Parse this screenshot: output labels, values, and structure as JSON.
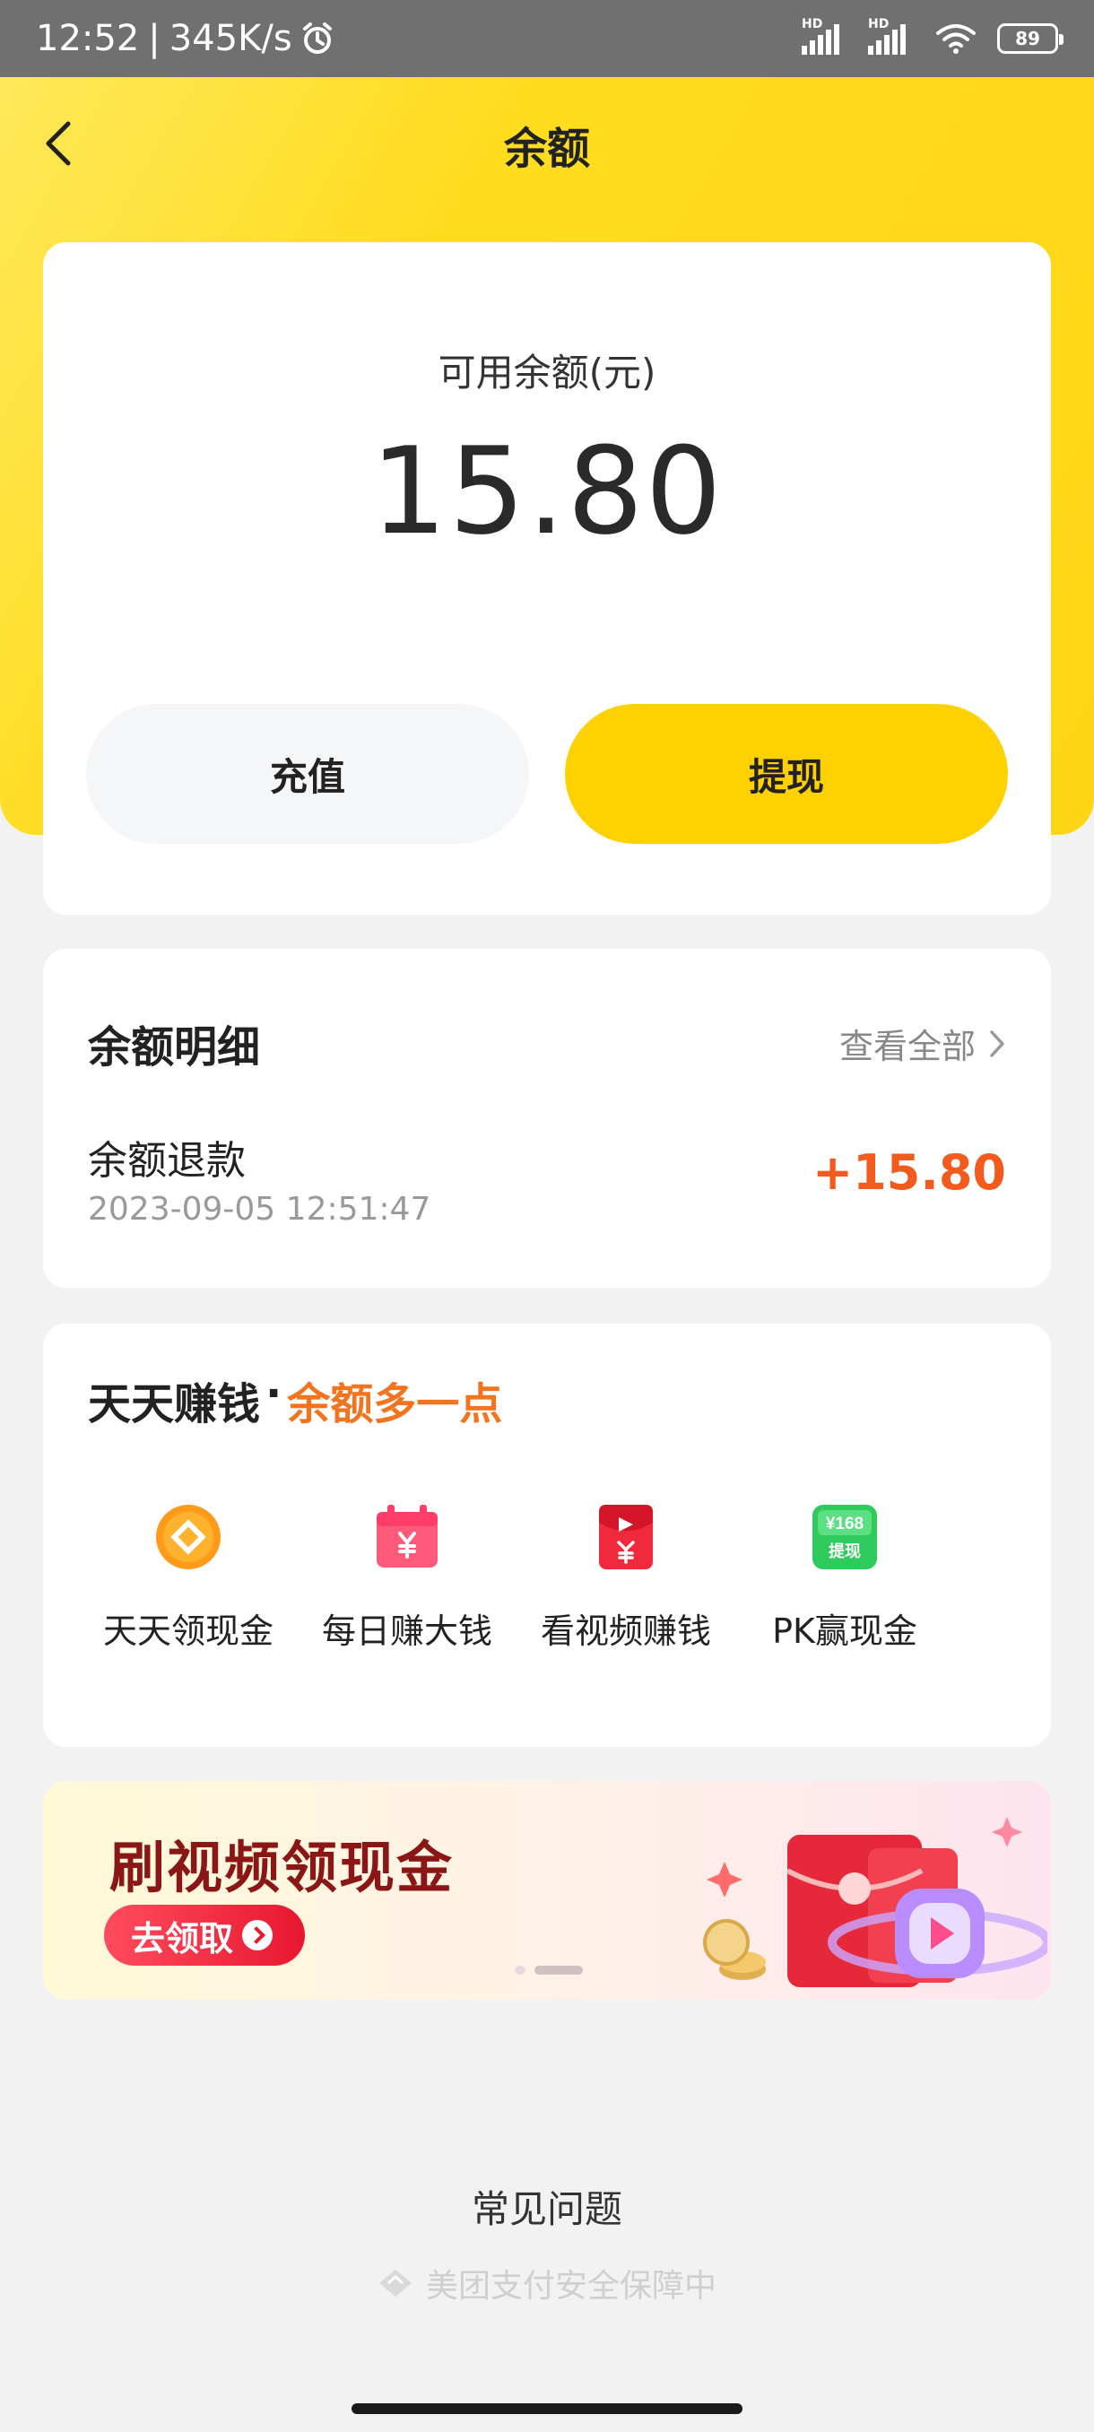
{
  "status_bar": {
    "time": "12:52",
    "network_speed": "345K/s",
    "signal_label_1": "HD",
    "signal_label_2": "HD",
    "battery": "89",
    "icons": [
      "alarm-icon",
      "signal-icon",
      "signal-icon",
      "wifi-icon",
      "battery-icon"
    ]
  },
  "nav": {
    "title": "余额",
    "back_icon": "chevron-left-icon"
  },
  "balance": {
    "label": "可用余额(元)",
    "amount": "15.80",
    "recharge_label": "充值",
    "withdraw_label": "提现"
  },
  "detail": {
    "title": "余额明细",
    "view_all": "查看全部",
    "transactions": [
      {
        "name": "余额退款",
        "time": "2023-09-05 12:51:47",
        "amount": "+15.80"
      }
    ]
  },
  "earn": {
    "title_main": "天天赚钱",
    "title_sep": "·",
    "title_accent": "余额多一点",
    "items": [
      {
        "label": "天天领现金",
        "icon": "coin-icon"
      },
      {
        "label": "每日赚大钱",
        "icon": "calendar-yuan-icon"
      },
      {
        "label": "看视频赚钱",
        "icon": "red-envelope-icon"
      },
      {
        "label": "PK赢现金",
        "icon": "withdraw-168-icon",
        "icon_text_1": "¥168",
        "icon_text_2": "提现"
      }
    ]
  },
  "banner": {
    "title": "刷视频领现金",
    "button": "去领取"
  },
  "footer": {
    "faq": "常见问题",
    "secure": "美团支付安全保障中"
  },
  "colors": {
    "brand_yellow": "#ffd100",
    "amount_orange": "#f25a1e",
    "accent_orange": "#f2741e"
  }
}
